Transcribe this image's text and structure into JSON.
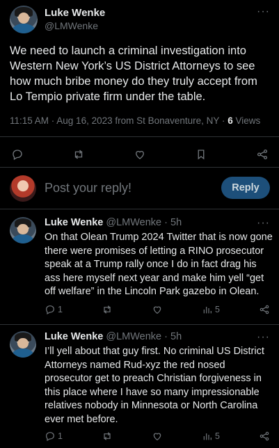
{
  "main_tweet": {
    "author_name": "Luke Wenke",
    "author_handle": "@LMWenke",
    "more": "···",
    "text": "We need to launch a criminal investigation into Western New York’s US District Attorneys to see how much bribe money do they truly accept from Lo Tempio private firm under the table.",
    "timestamp": "11:15 AM · Aug 16, 2023 from St Bonaventure, NY ·",
    "views_count": "6",
    "views_label": "Views"
  },
  "composer": {
    "placeholder": "Post your reply!",
    "reply_label": "Reply"
  },
  "replies": [
    {
      "author_name": "Luke Wenke",
      "author_handle": "@LMWenke",
      "age": "· 5h",
      "more": "···",
      "text": "On that Olean Trump 2024 Twitter that is now gone there were promises of letting a RINO prosecutor speak at a Trump rally once I do in fact drag his ass here myself next year and make him yell “get off welfare” in the Lincoln Park gazebo in Olean.",
      "reply_count": "1",
      "views": "5"
    },
    {
      "author_name": "Luke Wenke",
      "author_handle": "@LMWenke",
      "age": "· 5h",
      "more": "···",
      "text": "I’ll yell about that guy first.  No criminal US District Attorneys named Rud-xyz the red nosed prosecutor get to preach Christian forgiveness in this place where I have so many impressionable relatives nobody in Minnesota or North Carolina ever met before.",
      "reply_count": "1",
      "views": "5"
    }
  ],
  "icons": [
    "reply-icon",
    "retweet-icon",
    "like-icon",
    "bookmark-icon",
    "share-icon",
    "views-icon",
    "more-icon"
  ],
  "colors": {
    "background": "#000000",
    "text": "#e7e9ea",
    "muted": "#71767b",
    "reply_button": "#1d4f7a"
  }
}
